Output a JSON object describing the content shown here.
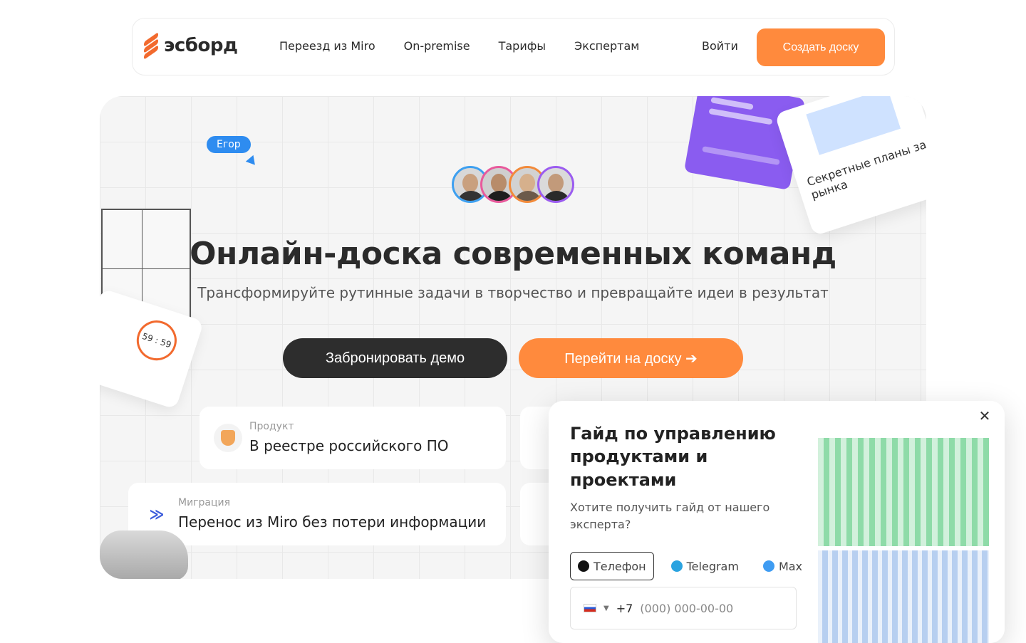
{
  "brand": {
    "name": "эсборд",
    "accent": "#ff8a3d"
  },
  "nav": {
    "items": [
      "Переезд из Miro",
      "On-premise",
      "Тарифы",
      "Экспертам"
    ],
    "login": "Войти",
    "create": "Создать доску"
  },
  "hero": {
    "cursor_name": "Егор",
    "title": "Онлайн-доска современных команд",
    "subtitle": "Трансформируйте рутинные задачи в творчество и превращайте идеи в результат",
    "demo_button": "Забронировать демо",
    "board_button": "Перейти на доску ➔",
    "timer": "59 : 59",
    "card_title": "Секретные планы за рынка"
  },
  "features": [
    {
      "kicker": "Продукт",
      "text": "В реестре российского ПО",
      "icon": "shield-icon"
    },
    {
      "kicker": "Миграция",
      "text": "Перенос из Miro без потери информации",
      "icon": "miro-icon"
    }
  ],
  "popup": {
    "title": "Гайд по управлению продуктами и проектами",
    "subtitle": "Хотите получить гайд от нашего эксперта?",
    "tabs": [
      "Телефон",
      "Telegram",
      "Max"
    ],
    "phone_prefix": "+7",
    "phone_placeholder": "(000) 000-00-00"
  }
}
